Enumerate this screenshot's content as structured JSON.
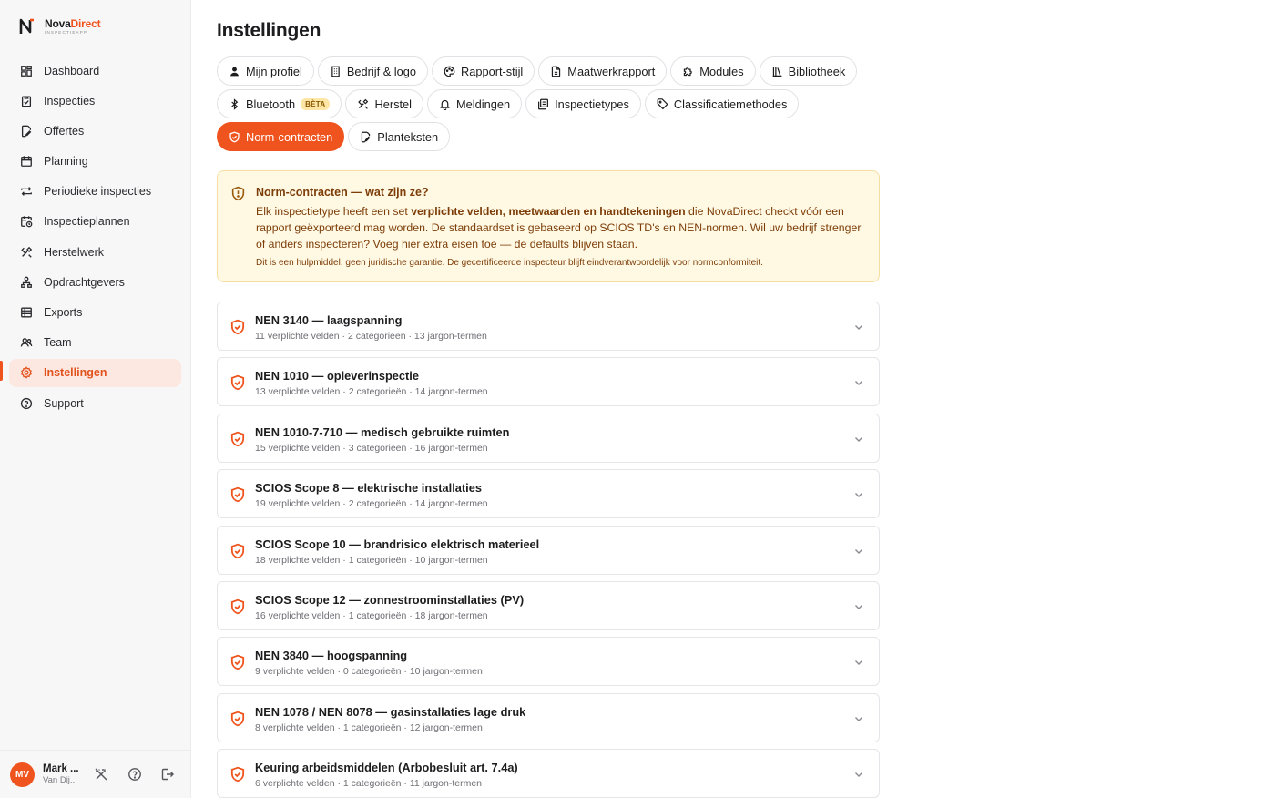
{
  "brand": {
    "name_part1": "Nova",
    "name_part2": "Direct",
    "tagline": "INSPECTIEAPP"
  },
  "sidebar": {
    "items": [
      {
        "label": "Dashboard",
        "icon": "grid-icon"
      },
      {
        "label": "Inspecties",
        "icon": "clipboard-check-icon"
      },
      {
        "label": "Offertes",
        "icon": "file-edit-icon"
      },
      {
        "label": "Planning",
        "icon": "calendar-icon"
      },
      {
        "label": "Periodieke inspecties",
        "icon": "repeat-icon"
      },
      {
        "label": "Inspectieplannen",
        "icon": "calendar-clock-icon"
      },
      {
        "label": "Herstelwerk",
        "icon": "tools-icon"
      },
      {
        "label": "Opdrachtgevers",
        "icon": "network-icon"
      },
      {
        "label": "Exports",
        "icon": "spreadsheet-icon"
      },
      {
        "label": "Team",
        "icon": "users-icon"
      },
      {
        "label": "Instellingen",
        "icon": "gear-icon",
        "active": true
      },
      {
        "label": "Support",
        "icon": "help-circle-icon"
      }
    ]
  },
  "user": {
    "initials": "MV",
    "name": "Mark ...",
    "sub": "Van Dij..."
  },
  "page": {
    "title": "Instellingen"
  },
  "tabs": [
    {
      "label": "Mijn profiel",
      "icon": "user-icon"
    },
    {
      "label": "Bedrijf & logo",
      "icon": "building-icon"
    },
    {
      "label": "Rapport-stijl",
      "icon": "palette-icon"
    },
    {
      "label": "Maatwerkrapport",
      "icon": "file-icon"
    },
    {
      "label": "Modules",
      "icon": "puzzle-icon"
    },
    {
      "label": "Bibliotheek",
      "icon": "library-icon"
    },
    {
      "label": "Bluetooth",
      "icon": "bluetooth-icon",
      "badge": "BÈTA"
    },
    {
      "label": "Herstel",
      "icon": "tools-icon"
    },
    {
      "label": "Meldingen",
      "icon": "bell-icon"
    },
    {
      "label": "Inspectietypes",
      "icon": "stack-icon"
    },
    {
      "label": "Classificatiemethodes",
      "icon": "tag-icon"
    },
    {
      "label": "Norm-contracten",
      "icon": "shield-check-icon",
      "active": true
    },
    {
      "label": "Planteksten",
      "icon": "file-edit-icon"
    }
  ],
  "info": {
    "title": "Norm-contracten — wat zijn ze?",
    "body_pre": "Elk inspectietype heeft een set ",
    "body_bold": "verplichte velden, meetwaarden en handtekeningen",
    "body_post": " die NovaDirect checkt vóór een rapport geëxporteerd mag worden. De standaardset is gebaseerd op SCIOS TD's en NEN-normen. Wil uw bedrijf strenger of anders inspecteren? Voeg hier extra eisen toe — de defaults blijven staan.",
    "note": "Dit is een hulpmiddel, geen juridische garantie. De gecertificeerde inspecteur blijft eindverantwoordelijk voor normconformiteit."
  },
  "contracts": [
    {
      "title": "NEN 3140 — laagspanning",
      "meta": "11 verplichte velden · 2 categorieën · 13 jargon-termen"
    },
    {
      "title": "NEN 1010 — opleverinspectie",
      "meta": "13 verplichte velden · 2 categorieën · 14 jargon-termen"
    },
    {
      "title": "NEN 1010-7-710 — medisch gebruikte ruimten",
      "meta": "15 verplichte velden · 3 categorieën · 16 jargon-termen"
    },
    {
      "title": "SCIOS Scope 8 — elektrische installaties",
      "meta": "19 verplichte velden · 2 categorieën · 14 jargon-termen"
    },
    {
      "title": "SCIOS Scope 10 — brandrisico elektrisch materieel",
      "meta": "18 verplichte velden · 1 categorieën · 10 jargon-termen"
    },
    {
      "title": "SCIOS Scope 12 — zonnestroominstallaties (PV)",
      "meta": "16 verplichte velden · 1 categorieën · 18 jargon-termen"
    },
    {
      "title": "NEN 3840 — hoogspanning",
      "meta": "9 verplichte velden · 0 categorieën · 10 jargon-termen"
    },
    {
      "title": "NEN 1078 / NEN 8078 — gasinstallaties lage druk",
      "meta": "8 verplichte velden · 1 categorieën · 12 jargon-termen"
    },
    {
      "title": "Keuring arbeidsmiddelen (Arbobesluit art. 7.4a)",
      "meta": "6 verplichte velden · 1 categorieën · 11 jargon-termen"
    }
  ],
  "colors": {
    "accent": "#f0541e",
    "info_bg": "#fff8e3",
    "info_text": "#7c3d08"
  }
}
